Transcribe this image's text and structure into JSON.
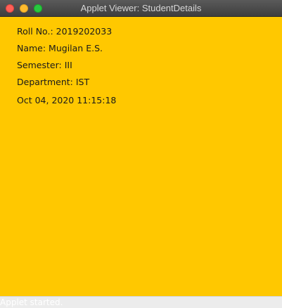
{
  "window": {
    "title": "Applet Viewer: StudentDetails"
  },
  "applet": {
    "background_color": "#ffc800",
    "lines": [
      "Roll No.: 2019202033",
      "Name: Mugilan E.S.",
      "Semester: III",
      "Department: IST",
      "Oct 04, 2020 11:15:18"
    ]
  },
  "status": {
    "text": "Applet started."
  }
}
